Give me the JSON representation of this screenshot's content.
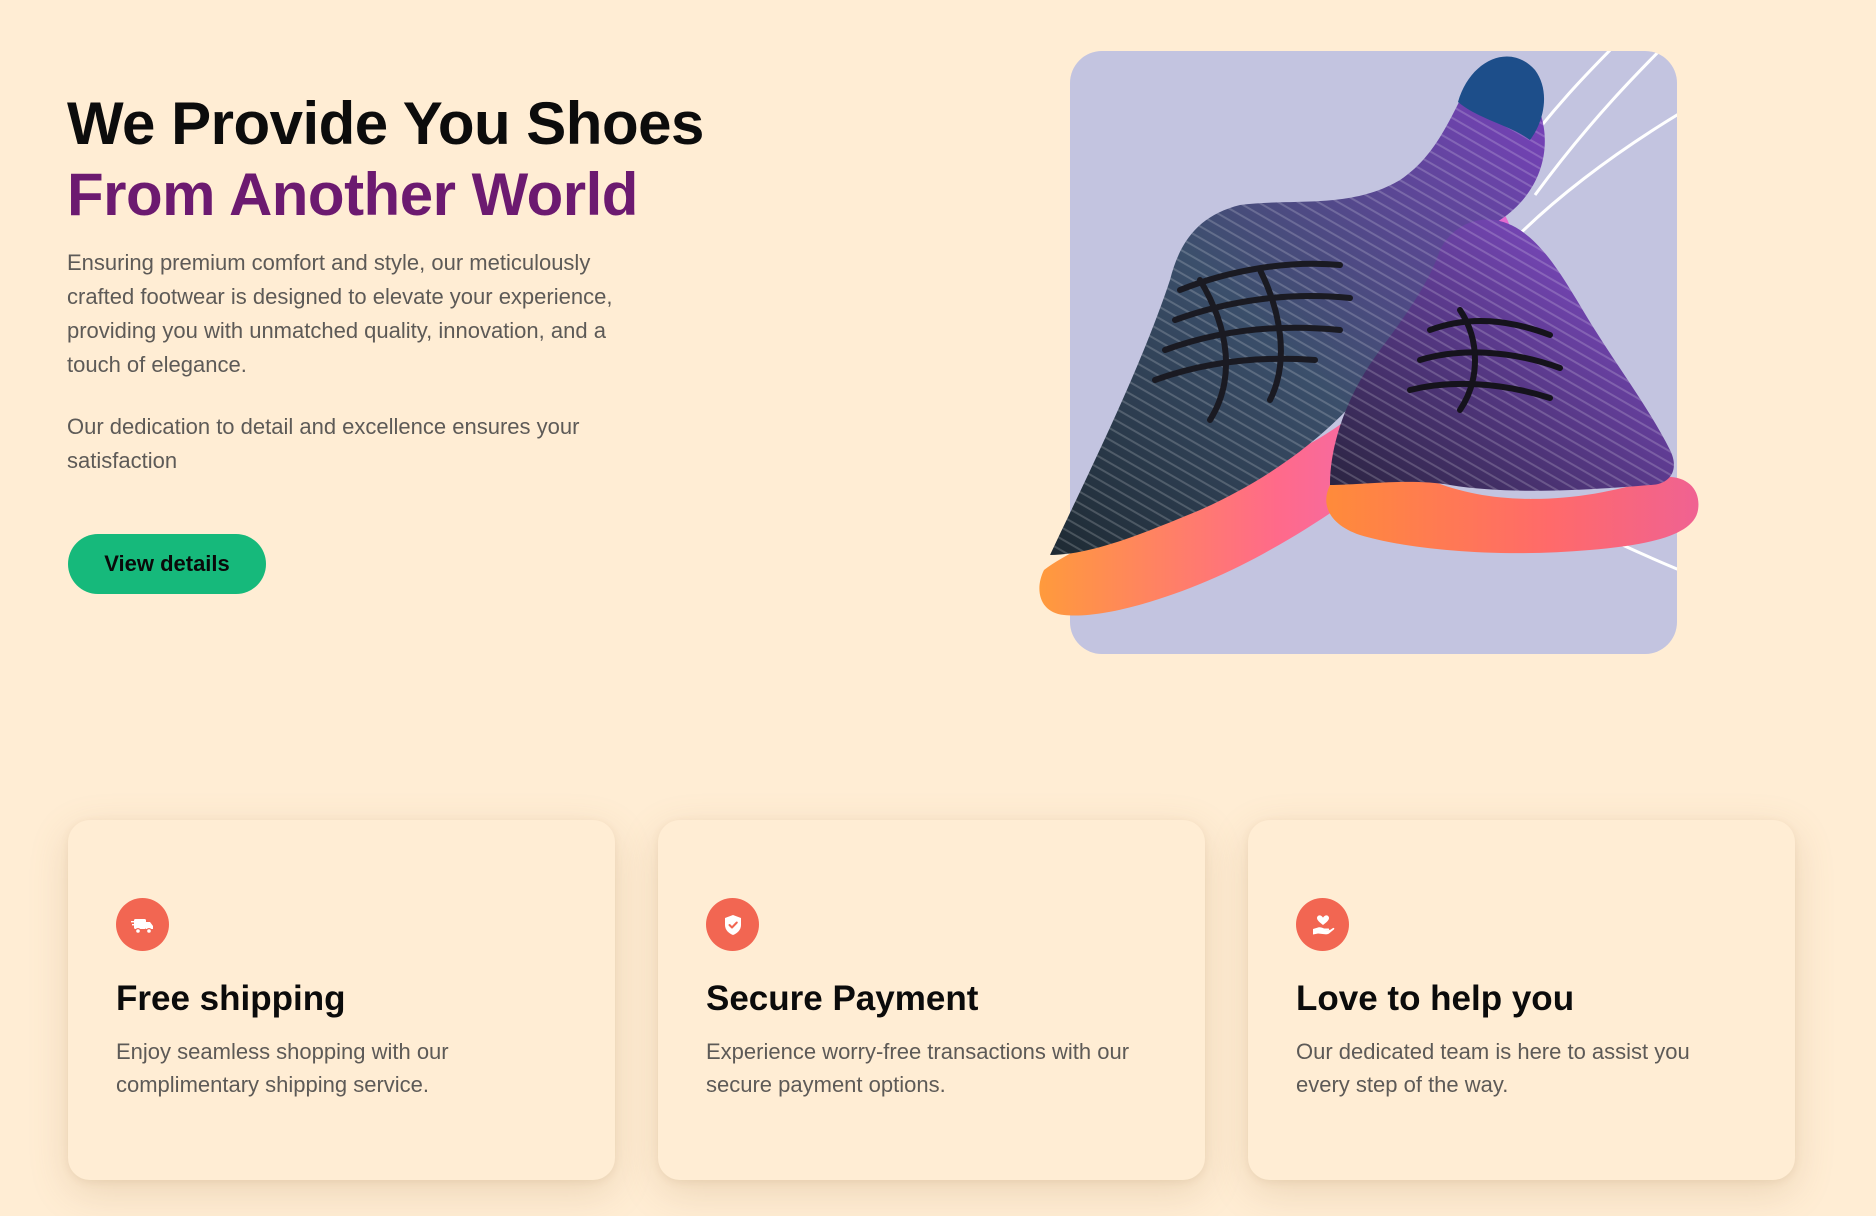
{
  "hero": {
    "headline_line1": "We Provide You Shoes",
    "headline_line2": "From Another World",
    "description": "Ensuring premium comfort and style, our meticulously crafted footwear is designed to elevate your experience, providing you with unmatched quality, innovation, and a touch of elegance.",
    "description_secondary": "Our dedication to detail and excellence ensures your satisfaction",
    "cta_label": "View details",
    "image": "sneakers-photo"
  },
  "colors": {
    "background": "#ffedd4",
    "headline_accent": "#6c1a70",
    "cta": "#16b97b",
    "icon_accent": "#f26652",
    "image_panel": "#c3c4e0"
  },
  "features": [
    {
      "icon": "delivery-truck-icon",
      "title": "Free shipping",
      "description": "Enjoy seamless shopping with our complimentary shipping service."
    },
    {
      "icon": "shield-check-icon",
      "title": "Secure Payment",
      "description": "Experience worry-free transactions with our secure payment options."
    },
    {
      "icon": "heart-hand-icon",
      "title": "Love to help you",
      "description": "Our dedicated team is here to assist you every step of the way."
    }
  ]
}
